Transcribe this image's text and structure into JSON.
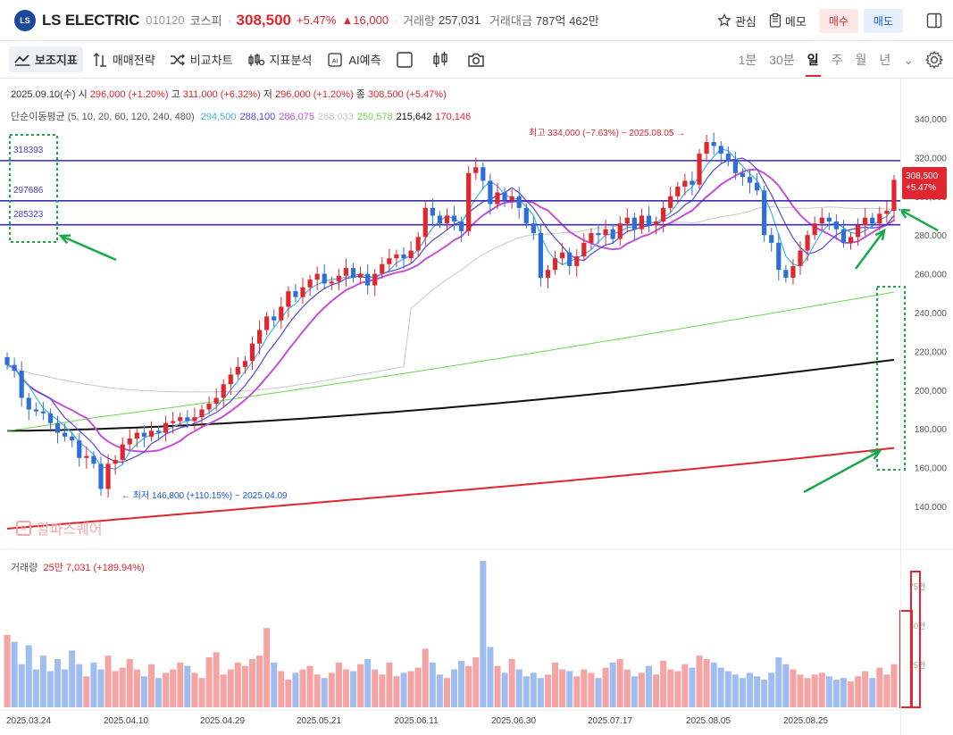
{
  "header": {
    "logo": "LS",
    "company": "LS ELECTRIC",
    "code": "010120",
    "market": "코스피",
    "price": "308,500",
    "change_pct": "+5.47%",
    "change_abs": "▲16,000",
    "volume_label": "거래량",
    "volume": "257,031",
    "amount_label": "거래대금",
    "amount": "787억 462만",
    "watch_label": "관심",
    "memo_label": "메모",
    "buy_label": "매수",
    "sell_label": "매도"
  },
  "toolbar": {
    "indicators": "보조지표",
    "strategy": "매매전략",
    "compare": "비교차트",
    "analysis": "지표분석",
    "ai": "AI예측",
    "periods": [
      "1분",
      "30분",
      "일",
      "주",
      "월",
      "년"
    ],
    "active_period": "일"
  },
  "ohlc": {
    "date": "2025.09.10(수)",
    "open_label": "시",
    "open": "296,000 (+1.20%)",
    "high_label": "고",
    "high": "311,000 (+6.32%)",
    "low_label": "저",
    "low": "296,000 (+1.20%)",
    "close_label": "종",
    "close": "308,500 (+5.47%)"
  },
  "ma": {
    "label": "단순이동평균 (5, 10, 20, 60, 120, 240, 480)",
    "values": [
      {
        "period": 5,
        "value": "294,500",
        "color": "#3fb6e8"
      },
      {
        "period": 10,
        "value": "288,100",
        "color": "#5548d6"
      },
      {
        "period": 20,
        "value": "286,075",
        "color": "#c64fd8"
      },
      {
        "period": 60,
        "value": "288,033",
        "color": "#c8c8c8"
      },
      {
        "period": 120,
        "value": "250,578",
        "color": "#6fd64f"
      },
      {
        "period": 240,
        "value": "215,642",
        "color": "#111111"
      },
      {
        "period": 480,
        "value": "170,146",
        "color": "#e0262f"
      }
    ]
  },
  "annotations": {
    "high": "최고 334,000 (−7.63%) − 2025.08.05 →",
    "low": "← 최저 146,800 (+110.15%) − 2025.04.09",
    "levels": [
      "318393",
      "297686",
      "285323"
    ],
    "price_tag": "308,500",
    "price_tag_pct": "+5.47%",
    "watermark": "알파스퀘어"
  },
  "volume_panel": {
    "label": "거래량",
    "value": "25만 7,031 (+189.94%)",
    "ticks": [
      "75만",
      "50만",
      "25만"
    ]
  },
  "chart_data": {
    "type": "candlestick",
    "y_ticks": [
      "340,000",
      "320,000",
      "300,000",
      "280,000",
      "260,000",
      "240,000",
      "220,000",
      "200,000",
      "180,000",
      "160,000",
      "140,000"
    ],
    "ylim": [
      120000,
      345000
    ],
    "x_tick_labels": [
      "2025.03.24",
      "2025.04.10",
      "2025.04.29",
      "2025.05.21",
      "2025.06.11",
      "2025.06.30",
      "2025.07.17",
      "2025.08.05",
      "2025.08.25"
    ],
    "horizontal_levels": [
      318393,
      297686,
      285323
    ],
    "close_series": [
      213000,
      210000,
      196000,
      190000,
      189000,
      188000,
      183000,
      178000,
      176000,
      174000,
      165000,
      166000,
      162000,
      149000,
      162000,
      164000,
      172000,
      175000,
      178000,
      176000,
      179000,
      178000,
      183000,
      184000,
      186000,
      184000,
      186000,
      190000,
      193000,
      196000,
      203000,
      208000,
      212000,
      215000,
      224000,
      231000,
      238000,
      236000,
      243000,
      251000,
      248000,
      253000,
      257000,
      260000,
      255000,
      256000,
      259000,
      263000,
      258000,
      260000,
      254000,
      260000,
      265000,
      268000,
      270000,
      268000,
      272000,
      279000,
      294000,
      290000,
      286000,
      290000,
      287000,
      282000,
      312000,
      315000,
      308000,
      296000,
      302000,
      298000,
      300000,
      294000,
      286000,
      281000,
      258000,
      262000,
      268000,
      271000,
      264000,
      269000,
      276000,
      281000,
      280000,
      283000,
      278000,
      286000,
      289000,
      283000,
      290000,
      285000,
      287000,
      294000,
      300000,
      305000,
      308000,
      306000,
      322000,
      328000,
      326000,
      322000,
      318000,
      312000,
      310000,
      307000,
      303000,
      280000,
      276000,
      262000,
      258000,
      264000,
      272000,
      280000,
      286000,
      289000,
      287000,
      283000,
      276000,
      279000,
      285000,
      289000,
      286000,
      291000,
      292500,
      308500
    ],
    "volume_series": [
      42,
      38,
      25,
      36,
      22,
      30,
      21,
      28,
      22,
      33,
      25,
      18,
      26,
      22,
      30,
      21,
      23,
      28,
      22,
      18,
      25,
      17,
      20,
      22,
      26,
      24,
      20,
      17,
      29,
      32,
      19,
      22,
      26,
      24,
      28,
      30,
      46,
      26,
      21,
      16,
      20,
      22,
      24,
      19,
      17,
      20,
      26,
      22,
      21,
      25,
      28,
      22,
      19,
      26,
      18,
      20,
      21,
      23,
      34,
      26,
      19,
      17,
      22,
      27,
      24,
      29,
      85,
      35,
      24,
      20,
      28,
      22,
      18,
      20,
      17,
      19,
      26,
      22,
      21,
      18,
      22,
      20,
      17,
      23,
      26,
      28,
      22,
      18,
      20,
      24,
      19,
      27,
      22,
      21,
      25,
      23,
      30,
      28,
      26,
      23,
      21,
      19,
      17,
      20,
      18,
      16,
      20,
      29,
      25,
      22,
      19,
      17,
      19,
      20,
      18,
      16,
      17,
      15,
      18,
      21,
      17,
      23,
      19,
      25
    ]
  }
}
